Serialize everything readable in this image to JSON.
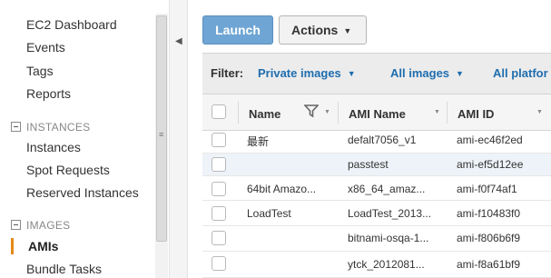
{
  "sidebar": {
    "items_top": [
      "EC2 Dashboard",
      "Events",
      "Tags",
      "Reports"
    ],
    "section_instances": "INSTANCES",
    "instances_items": [
      "Instances",
      "Spot Requests",
      "Reserved Instances"
    ],
    "section_images": "IMAGES",
    "images_items": [
      "AMIs",
      "Bundle Tasks"
    ],
    "active_item": "AMIs"
  },
  "toolbar": {
    "launch_label": "Launch",
    "actions_label": "Actions"
  },
  "filter": {
    "label": "Filter:",
    "options": [
      "Private images",
      "All images",
      "All platfor"
    ]
  },
  "table": {
    "columns": [
      "Name",
      "AMI Name",
      "AMI ID"
    ],
    "rows": [
      {
        "name": "最新",
        "ami_name": "defalt7056_v1",
        "ami_id": "ami-ec46f2ed"
      },
      {
        "name": "",
        "ami_name": "passtest",
        "ami_id": "ami-ef5d12ee"
      },
      {
        "name": "64bit Amazo...",
        "ami_name": "x86_64_amaz...",
        "ami_id": "ami-f0f74af1"
      },
      {
        "name": "LoadTest",
        "ami_name": "LoadTest_2013...",
        "ami_id": "ami-f10483f0"
      },
      {
        "name": "",
        "ami_name": "bitnami-osqa-1...",
        "ami_id": "ami-f806b6f9"
      },
      {
        "name": "",
        "ami_name": "ytck_2012081...",
        "ami_id": "ami-f8a61bf9"
      }
    ]
  },
  "colors": {
    "accent": "#e58a16",
    "link": "#1f6dae",
    "launch": "#6fa5d4"
  }
}
